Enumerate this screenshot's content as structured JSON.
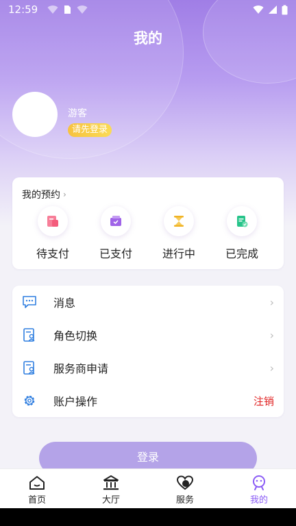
{
  "status_bar": {
    "time": "12:59"
  },
  "header": {
    "title": "我的"
  },
  "profile": {
    "name": "游客",
    "login_prompt": "请先登录"
  },
  "booking": {
    "title": "我的预约",
    "items": [
      {
        "label": "待支付",
        "icon": "pending-payment-icon",
        "color": "#f45c7c"
      },
      {
        "label": "已支付",
        "icon": "paid-wallet-icon",
        "color": "#a064e8"
      },
      {
        "label": "进行中",
        "icon": "hourglass-icon",
        "color": "#f0b323"
      },
      {
        "label": "已完成",
        "icon": "completed-doc-icon",
        "color": "#27c48a"
      }
    ]
  },
  "menu": {
    "items": [
      {
        "label": "消息",
        "icon": "message-icon"
      },
      {
        "label": "角色切换",
        "icon": "role-switch-icon"
      },
      {
        "label": "服务商申请",
        "icon": "provider-apply-icon"
      },
      {
        "label": "账户操作",
        "icon": "gear-icon",
        "action": "注销"
      }
    ]
  },
  "login_button": "登录",
  "tabbar": {
    "tabs": [
      {
        "label": "首页",
        "icon": "home-icon"
      },
      {
        "label": "大厅",
        "icon": "hall-icon"
      },
      {
        "label": "服务",
        "icon": "heart-icon"
      },
      {
        "label": "我的",
        "icon": "profile-icon",
        "active": true
      }
    ]
  },
  "colors": {
    "accent": "#8b5cf6",
    "danger": "#e02020",
    "menu_icon": "#2f7ee0",
    "badge": "#f7c23f"
  }
}
